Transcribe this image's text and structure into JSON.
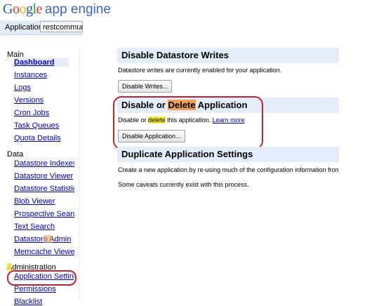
{
  "header": {
    "logo_text": "Google",
    "product_text": "app engine",
    "application_label": "Application:",
    "application_value": "restcommunity"
  },
  "sidebar": {
    "main_heading": "Main",
    "main_items": [
      "Dashboard",
      "Instances",
      "Logs",
      "Versions",
      "Cron Jobs",
      "Task Queues",
      "Quota Details"
    ],
    "data_heading": "Data",
    "data_items": [
      "Datastore Indexes",
      "Datastore Viewer",
      "Datastore Statistics",
      "Blob Viewer",
      "Prospective Search",
      "Text Search",
      "Datastore Admin",
      "Memcache Viewer"
    ],
    "admin_heading": "Administration",
    "admin_items": [
      "Application Settings",
      "Permissions",
      "Blacklist"
    ]
  },
  "content": {
    "writes": {
      "title": "Disable Datastore Writes",
      "description": "Datastore writes are currently enabled for your application.",
      "button": "Disable Writes..."
    },
    "delete": {
      "title_pre": "Disable or ",
      "title_highlight": "Delete",
      "title_post": " Application",
      "desc_pre": "Disable or ",
      "desc_highlight": "delete",
      "desc_post": " this application. ",
      "learn_more": "Learn more",
      "button": "Disable Application..."
    },
    "duplicate": {
      "title": "Duplicate Application Settings",
      "line1": "Create a new application by re-using much of the configuration information from",
      "line2": "Some caveats currently exist with this process."
    }
  },
  "colors": {
    "section_bar": "#e5ecf9",
    "link": "#0000cc",
    "highlight_yellow": "#f7ea32",
    "highlight_orange": "#f0a15a",
    "annotation_red": "#c8212b"
  }
}
